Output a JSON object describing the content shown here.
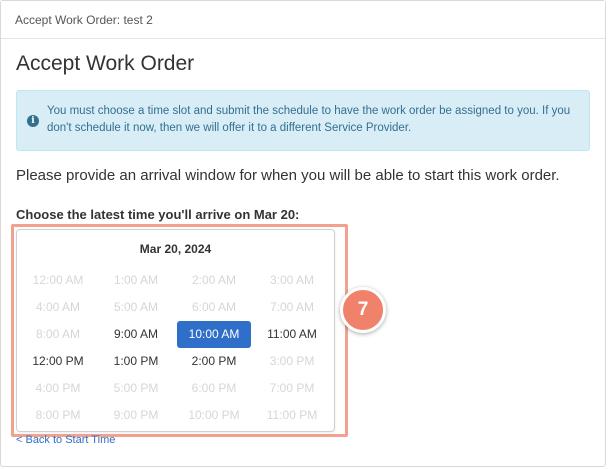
{
  "panel": {
    "header": "Accept Work Order: test 2",
    "title": "Accept Work Order"
  },
  "alert": {
    "icon": "info-circle-icon",
    "text": "You must choose a time slot and submit the schedule to have the work order be assigned to you. If you don't schedule it now, then we will offer it to a different Service Provider."
  },
  "prompt": "Please provide an arrival window for when you will be able to start this work order.",
  "choose_label": "Choose the latest time you'll arrive on Mar 20:",
  "picker": {
    "date": "Mar 20, 2024",
    "slots": [
      {
        "label": "12:00 AM",
        "state": "disabled"
      },
      {
        "label": "1:00 AM",
        "state": "disabled"
      },
      {
        "label": "2:00 AM",
        "state": "disabled"
      },
      {
        "label": "3:00 AM",
        "state": "disabled"
      },
      {
        "label": "4:00 AM",
        "state": "disabled"
      },
      {
        "label": "5:00 AM",
        "state": "disabled"
      },
      {
        "label": "6:00 AM",
        "state": "disabled"
      },
      {
        "label": "7:00 AM",
        "state": "disabled"
      },
      {
        "label": "8:00 AM",
        "state": "disabled"
      },
      {
        "label": "9:00 AM",
        "state": "available"
      },
      {
        "label": "10:00 AM",
        "state": "selected"
      },
      {
        "label": "11:00 AM",
        "state": "available"
      },
      {
        "label": "12:00 PM",
        "state": "available"
      },
      {
        "label": "1:00 PM",
        "state": "available"
      },
      {
        "label": "2:00 PM",
        "state": "available"
      },
      {
        "label": "3:00 PM",
        "state": "disabled"
      },
      {
        "label": "4:00 PM",
        "state": "disabled"
      },
      {
        "label": "5:00 PM",
        "state": "disabled"
      },
      {
        "label": "6:00 PM",
        "state": "disabled"
      },
      {
        "label": "7:00 PM",
        "state": "disabled"
      },
      {
        "label": "8:00 PM",
        "state": "disabled"
      },
      {
        "label": "9:00 PM",
        "state": "disabled"
      },
      {
        "label": "10:00 PM",
        "state": "disabled"
      },
      {
        "label": "11:00 PM",
        "state": "disabled"
      }
    ]
  },
  "step_badge": "7",
  "back_link": "< Back to Start Time",
  "colors": {
    "accent": "#2f6fc9",
    "alert_bg": "#d9edf7",
    "alert_text": "#31708f",
    "highlight": "#f2a090",
    "badge": "#f0826c"
  }
}
